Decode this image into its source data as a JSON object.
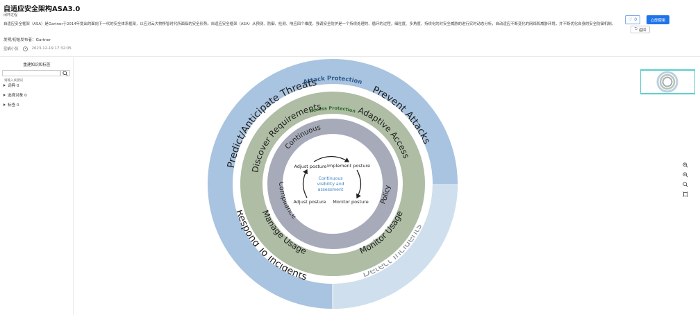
{
  "header": {
    "title": "自适应安全架构ASA3.0",
    "subtitle": "闭环过程",
    "description": "自适应安全框架（ASA）是Gartner于2014年提出的面向下一代的安全体系框架，以应对云大物移智时代所面临的安全形势。自适应安全框架（ASA）从预测、防御、检测、响应四个维度，强调安全防护是一个持续处理的、循环的过程，细粒度、多角度、持续化的对安全威胁的进行实时动态分析，自动适应不断变化的网络和威胁环境，并不断优化自身的安全防御机制。",
    "publisher": "发明/初始发布者：Gartner",
    "author": "蓝蜗小张",
    "timestamp": "2023-12-19 17:32:05",
    "like_count": "0",
    "use_label": "立即使用",
    "back_label": "返回"
  },
  "sidebar": {
    "title": "重建知识和标签",
    "search_placeholder": "请输入关键词",
    "items": [
      {
        "label": "词典 0"
      },
      {
        "label": "选择对象 0"
      },
      {
        "label": "标签 0"
      }
    ]
  },
  "diagram": {
    "outer_ring": {
      "top_label": "Attack Protection",
      "segments": [
        "Predict/Anticipate Threats",
        "Prevent Attacks",
        "Detect Incidents",
        "Respond To Incidents"
      ]
    },
    "middle_ring": {
      "top_label": "Access Protection",
      "segments": [
        "Discover Requirements",
        "Adaptive Access",
        "Monitor Usage",
        "Manage Usage"
      ]
    },
    "inner_ring": {
      "segments": [
        "Continuous",
        "Compliance",
        "Policy"
      ]
    },
    "center": {
      "posture_labels": [
        "Adjust posture",
        "Implement posture",
        "Monitor posture",
        "Adjust posture"
      ],
      "core_lines": [
        "Continuous",
        "visibility and",
        "assessment"
      ]
    },
    "colors": {
      "outer": "#a9c4e0",
      "outer_detect": "#cfdfee",
      "middle": "#aebda4",
      "inner": "#a6aab9",
      "core_text": "#3f82c4",
      "attack_text": "#2f5a8c",
      "access_text": "#2f6b2a"
    }
  }
}
